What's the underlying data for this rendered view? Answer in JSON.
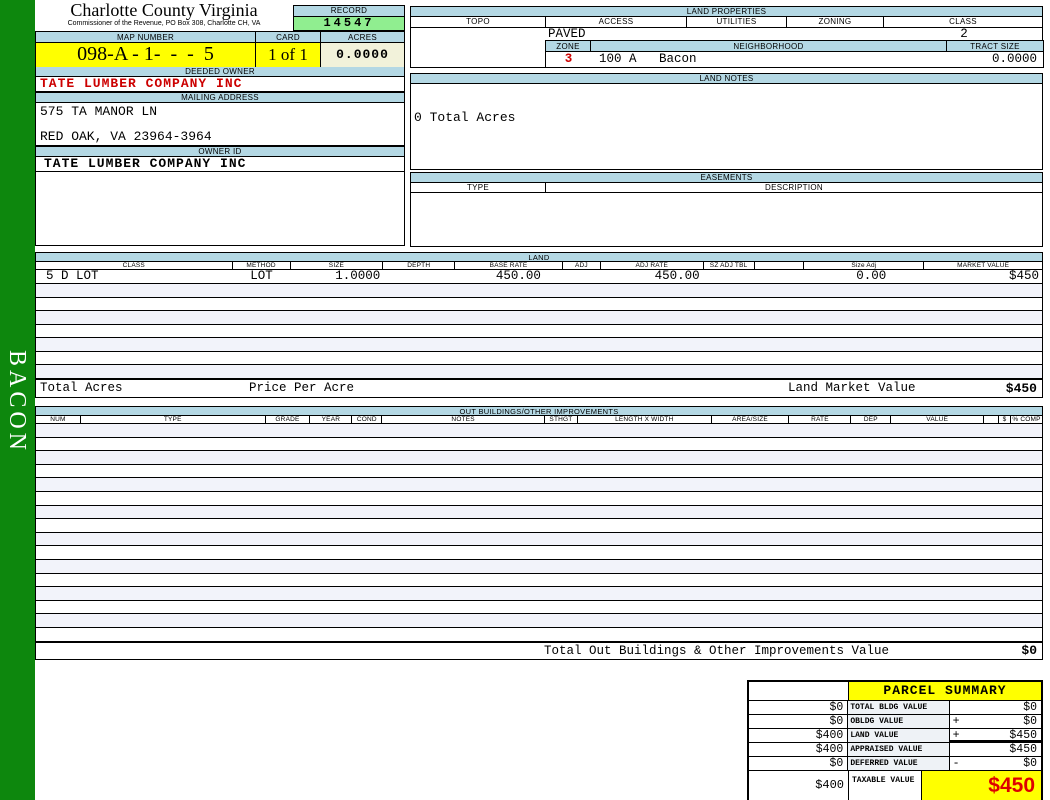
{
  "sidebar": {
    "vertical_label": "BACON"
  },
  "county": {
    "title": "Charlotte County Virginia",
    "subtitle": "Commissioner of the Revenue, PO Box 308, Charlotte CH, VA"
  },
  "record": {
    "label": "RECORD",
    "value": "14547"
  },
  "map": {
    "label": "MAP NUMBER",
    "value": "098-A - 1-  -  -  5"
  },
  "card": {
    "label": "CARD",
    "value": "1 of 1"
  },
  "acres": {
    "label": "ACRES",
    "value": "0.0000"
  },
  "deeded_owner": {
    "label": "DEEDED OWNER",
    "value": "TATE LUMBER COMPANY INC"
  },
  "mailing": {
    "label": "MAILING ADDRESS",
    "line1": "575 TA MANOR LN",
    "line2": "RED OAK, VA 23964-3964"
  },
  "owner_id": {
    "label": "OWNER ID",
    "value": "TATE LUMBER COMPANY INC"
  },
  "land_properties": {
    "title": "LAND PROPERTIES",
    "headers": [
      "TOPO",
      "ACCESS",
      "UTILITIES",
      "ZONING",
      "CLASS"
    ],
    "access": "PAVED",
    "class": "2",
    "zone_label": "ZONE",
    "zone": "3",
    "neighborhood_label": "NEIGHBORHOOD",
    "neighborhood": "100 A   Bacon",
    "tract_label": "TRACT SIZE",
    "tract_size": "0.0000"
  },
  "land_notes": {
    "title": "LAND NOTES",
    "text": "0 Total Acres"
  },
  "easements": {
    "title": "EASEMENTS",
    "type_label": "TYPE",
    "desc_label": "DESCRIPTION"
  },
  "land_table": {
    "title": "LAND",
    "headers": [
      "CLASS",
      "METHOD",
      "SIZE",
      "DEPTH",
      "BASE RATE",
      "ADJ",
      "ADJ RATE",
      "SZ ADJ TBL",
      "",
      "Size Adj",
      "MARKET VALUE"
    ],
    "rows": [
      {
        "class": "5 D LOT",
        "method": "LOT",
        "size": "1.0000",
        "depth": "",
        "base_rate": "450.00",
        "adj": "",
        "adj_rate": "450.00",
        "sz_adj_tbl": "",
        "size_adj": "0.00",
        "market_value": "$450"
      }
    ],
    "empty_row_count": 7,
    "totals": {
      "total_acres_label": "Total Acres",
      "price_per_acre_label": "Price Per Acre",
      "land_market_value_label": "Land Market Value",
      "land_market_value": "$450"
    }
  },
  "out_buildings": {
    "title": "OUT BUILDINGS/OTHER IMPROVEMENTS",
    "headers": [
      "NUM",
      "TYPE",
      "GRADE",
      "YEAR",
      "COND",
      "NOTES",
      "STHGT",
      "LENGTH X WIDTH",
      "AREA/SIZE",
      "RATE",
      "DEP",
      "VALUE",
      "",
      "$",
      "% COMP"
    ],
    "empty_row_count": 16,
    "total_label": "Total Out Buildings & Other Improvements Value",
    "total_value": "$0"
  },
  "parcel_summary": {
    "title": "PARCEL SUMMARY",
    "rows": [
      {
        "prior": "$0",
        "label": "TOTAL BLDG VALUE",
        "op": "",
        "value": "$0"
      },
      {
        "prior": "$0",
        "label": "OBLDG VALUE",
        "op": "+",
        "value": "$0"
      },
      {
        "prior": "$400",
        "label": "LAND VALUE",
        "op": "+",
        "value": "$450"
      },
      {
        "prior": "$400",
        "label": "APPRAISED VALUE",
        "op": "",
        "value": "$450"
      },
      {
        "prior": "$0",
        "label": "DEFERRED VALUE",
        "op": "-",
        "value": "$0"
      }
    ],
    "taxable": {
      "prior": "$400",
      "label": "TAXABLE VALUE",
      "value": "$450"
    }
  },
  "colors": {
    "header_blue": "#b4d8e4",
    "record_green": "#90ee90",
    "highlight_yellow": "#ffff00",
    "acres_cream": "#f2f2da",
    "sidebar_green": "#0d870d",
    "alert_red": "#cc0000",
    "row_alt": "#f2f3fa"
  }
}
